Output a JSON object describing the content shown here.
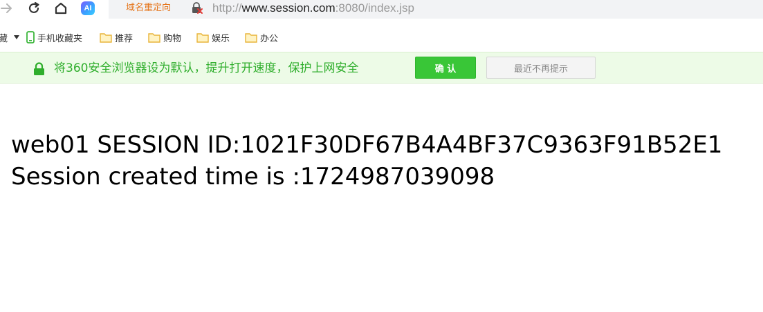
{
  "toolbar": {
    "ai_badge_label": "AI",
    "icons": [
      "forward-arrow-icon",
      "refresh-icon",
      "home-icon",
      "ai-badge-icon"
    ]
  },
  "address_bar": {
    "redirect_label": "域名重定向",
    "security_icon": "insecure-lock-icon",
    "url_prefix": "http://",
    "url_host": "www.session.com",
    "url_rest": ":8080/index.jsp"
  },
  "bookmarks": {
    "partial_label": "藏",
    "items": [
      {
        "label": "手机收藏夹",
        "icon": "phone-icon"
      },
      {
        "label": "推荐",
        "icon": "folder-icon"
      },
      {
        "label": "购物",
        "icon": "folder-icon"
      },
      {
        "label": "娱乐",
        "icon": "folder-icon"
      },
      {
        "label": "办公",
        "icon": "folder-icon"
      }
    ]
  },
  "notice_bar": {
    "message": "将360安全浏览器设为默认，提升打开速度，保护上网安全",
    "confirm_label": "确 认",
    "dismiss_label": "最近不再提示",
    "colors": {
      "background": "#edfbe7",
      "text": "#2fae2c",
      "button": "#39c637"
    }
  },
  "page": {
    "line1": "web01 SESSION ID:1021F30DF67B4A4BF37C9363F91B52E1",
    "line2": "Session created time is :1724987039098"
  }
}
